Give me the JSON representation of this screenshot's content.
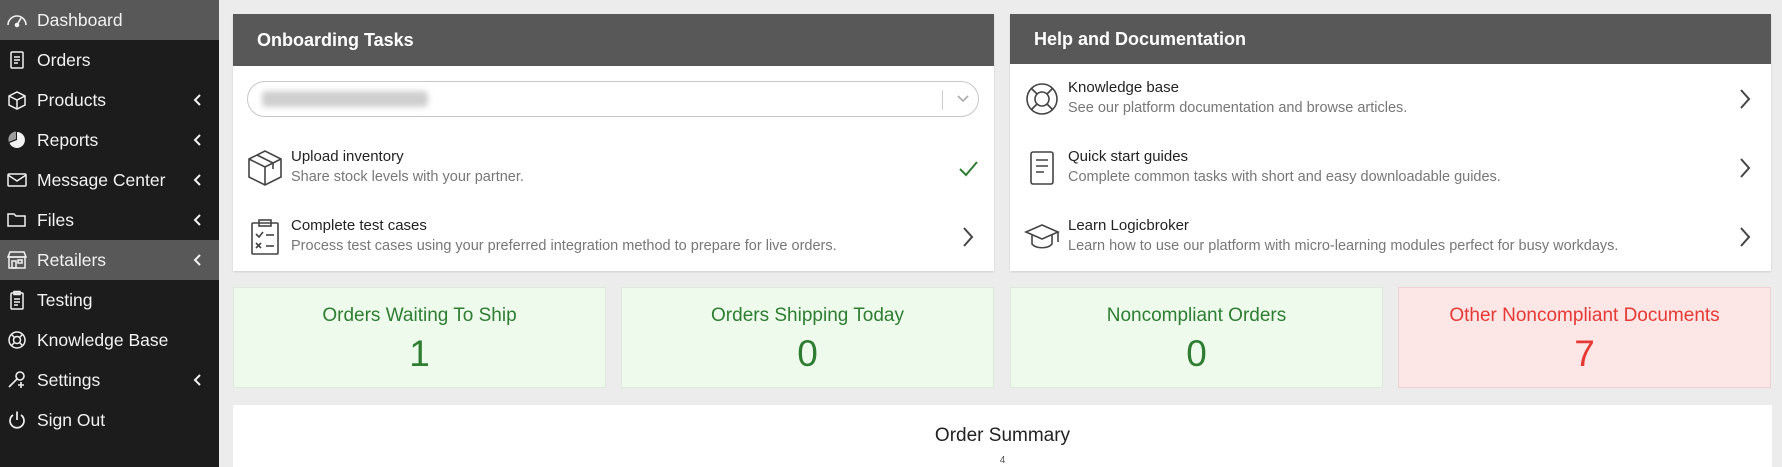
{
  "sidebar": {
    "items": [
      {
        "label": "Dashboard",
        "icon": "gauge-icon",
        "has_submenu": false,
        "active": true
      },
      {
        "label": "Orders",
        "icon": "receipt-icon",
        "has_submenu": false,
        "active": false
      },
      {
        "label": "Products",
        "icon": "box-icon",
        "has_submenu": true,
        "active": false
      },
      {
        "label": "Reports",
        "icon": "pie-chart-icon",
        "has_submenu": true,
        "active": false
      },
      {
        "label": "Message Center",
        "icon": "envelope-icon",
        "has_submenu": true,
        "active": false
      },
      {
        "label": "Files",
        "icon": "folder-icon",
        "has_submenu": true,
        "active": false
      },
      {
        "label": "Retailers",
        "icon": "storefront-icon",
        "has_submenu": true,
        "active": true
      },
      {
        "label": "Testing",
        "icon": "clipboard-icon",
        "has_submenu": false,
        "active": false
      },
      {
        "label": "Knowledge Base",
        "icon": "lifebuoy-icon",
        "has_submenu": false,
        "active": false
      },
      {
        "label": "Settings",
        "icon": "wrench-icon",
        "has_submenu": true,
        "active": false
      },
      {
        "label": "Sign Out",
        "icon": "power-icon",
        "has_submenu": false,
        "active": false
      }
    ]
  },
  "onboarding": {
    "title": "Onboarding Tasks",
    "tasks": [
      {
        "title": "Upload inventory",
        "description": "Share stock levels with your partner.",
        "icon": "package-icon",
        "status": "complete"
      },
      {
        "title": "Complete test cases",
        "description": "Process test cases using your preferred integration method to prepare for live orders.",
        "icon": "checklist-icon",
        "status": "pending"
      }
    ]
  },
  "help": {
    "title": "Help and Documentation",
    "items": [
      {
        "title": "Knowledge base",
        "description": "See our platform documentation and browse articles.",
        "icon": "lifebuoy-icon"
      },
      {
        "title": "Quick start guides",
        "description": "Complete common tasks with short and easy downloadable guides.",
        "icon": "document-icon"
      },
      {
        "title": "Learn Logicbroker",
        "description": "Learn how to use our platform with micro-learning modules perfect for busy workdays.",
        "icon": "graduation-cap-icon"
      }
    ]
  },
  "stats": [
    {
      "label": "Orders Waiting To Ship",
      "value": "1",
      "status": "ok"
    },
    {
      "label": "Orders Shipping Today",
      "value": "0",
      "status": "ok"
    },
    {
      "label": "Noncompliant Orders",
      "value": "0",
      "status": "ok"
    },
    {
      "label": "Other Noncompliant Documents",
      "value": "7",
      "status": "alert"
    }
  ],
  "summary": {
    "title": "Order Summary",
    "axis_top_tick": "4"
  },
  "colors": {
    "sidebar_bg": "#1c1c1c",
    "active_item": "#585858",
    "panel_header": "#585858",
    "ok_text": "#2e7d32",
    "ok_bg": "#eefbec",
    "alert_text": "#e53935",
    "alert_bg": "#fde6e6"
  }
}
